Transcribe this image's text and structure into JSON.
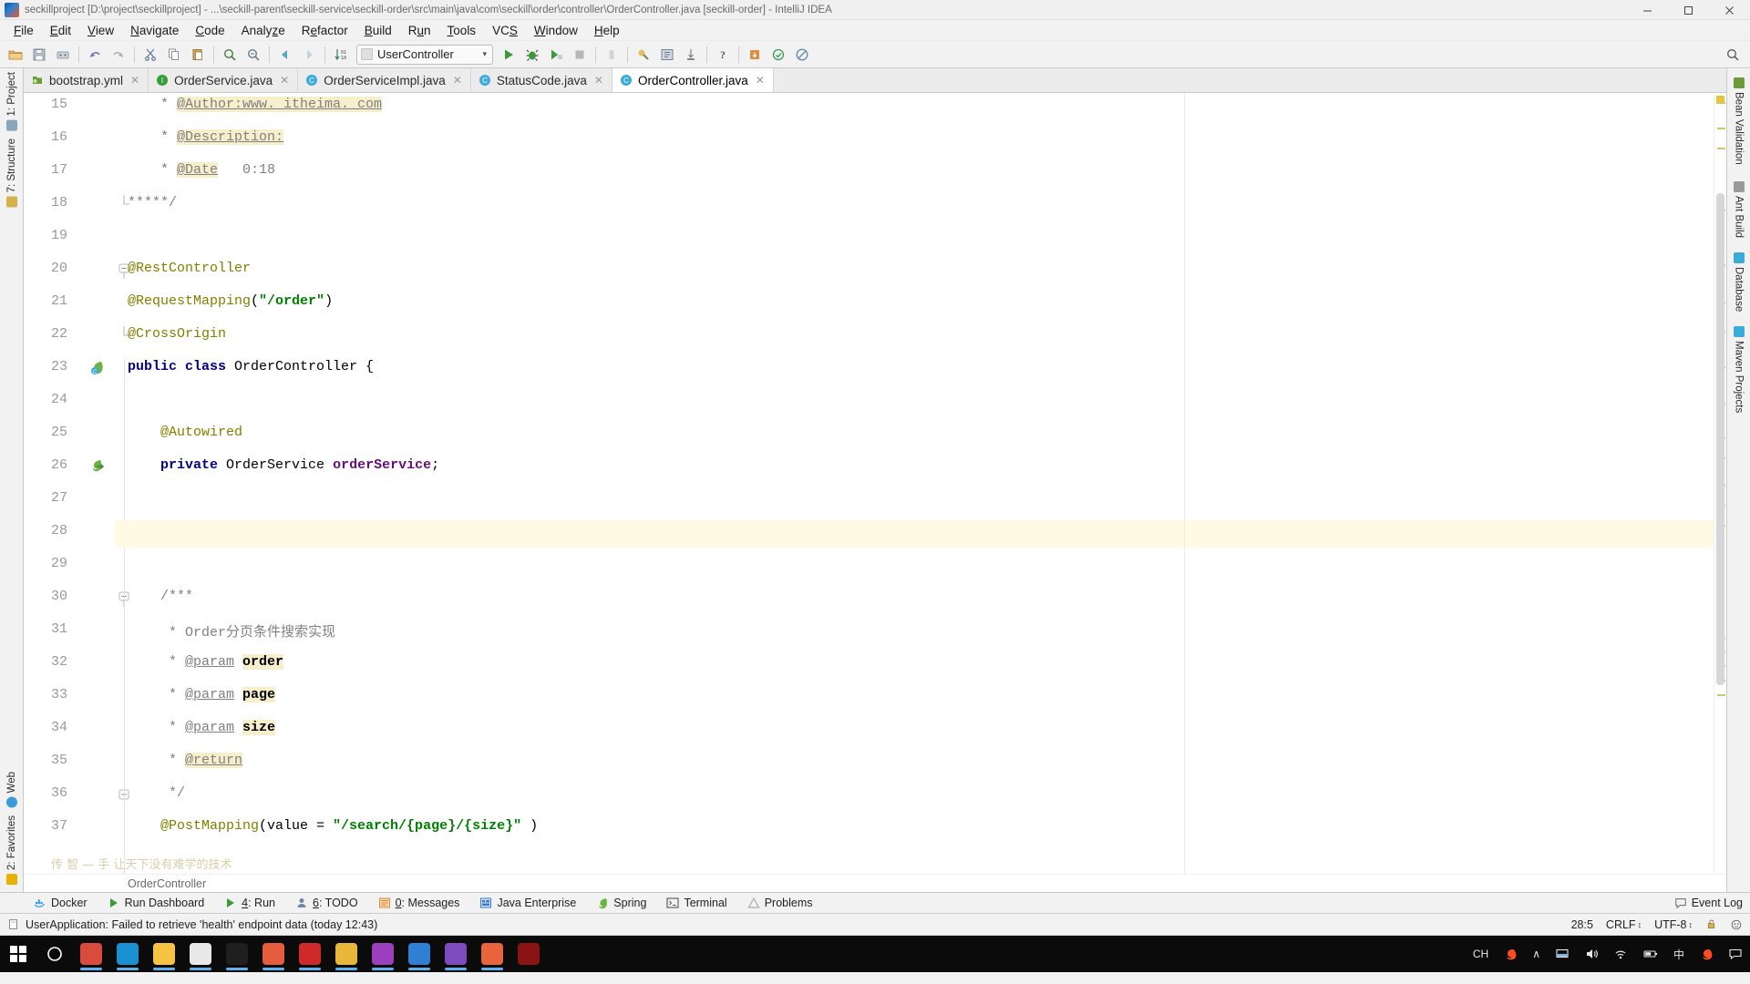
{
  "window": {
    "title": "seckillproject [D:\\project\\seckillproject] - ...\\seckill-parent\\seckill-service\\seckill-order\\src\\main\\java\\com\\seckill\\order\\controller\\OrderController.java [seckill-order] - IntelliJ IDEA",
    "app_icon": "intellij-idea-icon",
    "minimize": "–",
    "maximize": "❐",
    "close": "✕"
  },
  "menubar": {
    "items": [
      {
        "label": "File",
        "mnemonic": "F"
      },
      {
        "label": "Edit",
        "mnemonic": "E"
      },
      {
        "label": "View",
        "mnemonic": "V"
      },
      {
        "label": "Navigate",
        "mnemonic": "N"
      },
      {
        "label": "Code",
        "mnemonic": "C"
      },
      {
        "label": "Analyze",
        "mnemonic": "z"
      },
      {
        "label": "Refactor",
        "mnemonic": "e"
      },
      {
        "label": "Build",
        "mnemonic": "B"
      },
      {
        "label": "Run",
        "mnemonic": "u"
      },
      {
        "label": "Tools",
        "mnemonic": "T"
      },
      {
        "label": "VCS",
        "mnemonic": "S"
      },
      {
        "label": "Window",
        "mnemonic": "W"
      },
      {
        "label": "Help",
        "mnemonic": "H"
      }
    ]
  },
  "toolbar": {
    "left_icons": [
      "open-folder-icon",
      "save-all-icon",
      "sync-icon",
      "undo-icon",
      "redo-icon",
      "cut-icon",
      "copy-icon",
      "paste-icon",
      "find-icon",
      "replace-icon",
      "back-icon",
      "forward-icon",
      "sort-icon"
    ],
    "run_config": {
      "label": "UserController",
      "icon": "run-config-icon",
      "arrow": "⌄"
    },
    "run_icons": [
      "run-icon",
      "debug-icon",
      "run-coverage-icon",
      "stop-icon",
      "stop-disabled-icon",
      "profile-icon",
      "build-project-icon",
      "attach-icon",
      "help-icon",
      "update-app-icon",
      "favorites-icon",
      "no-entry-icon"
    ],
    "right_icons": [
      "search-everywhere-icon"
    ]
  },
  "tabs": [
    {
      "label": "bootstrap.yml",
      "icon": "yml-file-icon",
      "icon_color": "#6a9a3a",
      "icon_letter": "",
      "active": false,
      "closable": true
    },
    {
      "label": "OrderService.java",
      "icon": "java-interface-icon",
      "icon_color": "#389e3c",
      "icon_letter": "I",
      "active": false,
      "closable": true
    },
    {
      "label": "OrderServiceImpl.java",
      "icon": "java-class-icon",
      "icon_color": "#3cabd9",
      "icon_letter": "C",
      "active": false,
      "closable": true
    },
    {
      "label": "StatusCode.java",
      "icon": "java-class-icon",
      "icon_color": "#3cabd9",
      "icon_letter": "C",
      "active": false,
      "closable": true
    },
    {
      "label": "OrderController.java",
      "icon": "java-class-icon",
      "icon_color": "#3cabd9",
      "icon_letter": "C",
      "active": true,
      "closable": true
    }
  ],
  "editor": {
    "breadcrumb": "OrderController",
    "caret_line": 28,
    "first_visible_line": 15,
    "watermark": "传 智 — 手  让天下没有难学的技术",
    "gutter_icons": [
      {
        "line": 23,
        "icon": "spring-bean-class-icon"
      },
      {
        "line": 26,
        "icon": "spring-autowired-icon"
      }
    ],
    "lines": [
      {
        "n": 15,
        "segments": [
          {
            "t": "    * ",
            "c": "cmt"
          },
          {
            "t": "@Author:www. itheima. com",
            "c": "cmt-tag",
            "hl": true
          }
        ]
      },
      {
        "n": 16,
        "segments": [
          {
            "t": "    * ",
            "c": "cmt"
          },
          {
            "t": "@Description:",
            "c": "cmt-tag",
            "hl": true
          }
        ]
      },
      {
        "n": 17,
        "segments": [
          {
            "t": "    * ",
            "c": "cmt"
          },
          {
            "t": "@Date",
            "c": "cmt-tag",
            "hl": true
          },
          {
            "t": "   0:18",
            "c": "cmt"
          }
        ]
      },
      {
        "n": 18,
        "segments": [
          {
            "t": "*****/",
            "c": "cmt"
          }
        ]
      },
      {
        "n": 19,
        "segments": []
      },
      {
        "n": 20,
        "segments": [
          {
            "t": "@RestController",
            "c": "annot"
          }
        ]
      },
      {
        "n": 21,
        "segments": [
          {
            "t": "@RequestMapping",
            "c": "annot"
          },
          {
            "t": "(",
            "c": "plain"
          },
          {
            "t": "\"/order\"",
            "c": "str"
          },
          {
            "t": ")",
            "c": "plain"
          }
        ]
      },
      {
        "n": 22,
        "segments": [
          {
            "t": "@CrossOrigin",
            "c": "annot"
          }
        ]
      },
      {
        "n": 23,
        "segments": [
          {
            "t": "public class ",
            "c": "kw"
          },
          {
            "t": "OrderController {",
            "c": "plain"
          }
        ]
      },
      {
        "n": 24,
        "segments": []
      },
      {
        "n": 25,
        "segments": [
          {
            "t": "    @Autowired",
            "c": "annot"
          }
        ]
      },
      {
        "n": 26,
        "segments": [
          {
            "t": "    private ",
            "c": "kw"
          },
          {
            "t": "OrderService ",
            "c": "plain"
          },
          {
            "t": "orderService",
            "c": "field"
          },
          {
            "t": ";",
            "c": "plain"
          }
        ]
      },
      {
        "n": 27,
        "segments": []
      },
      {
        "n": 28,
        "segments": []
      },
      {
        "n": 29,
        "segments": []
      },
      {
        "n": 30,
        "segments": [
          {
            "t": "    /***",
            "c": "cmt"
          }
        ]
      },
      {
        "n": 31,
        "segments": [
          {
            "t": "     * Order分页条件搜索实现",
            "c": "cmt"
          }
        ]
      },
      {
        "n": 32,
        "segments": [
          {
            "t": "     * ",
            "c": "cmt"
          },
          {
            "t": "@param",
            "c": "cmt-tag"
          },
          {
            "t": " ",
            "c": "cmt"
          },
          {
            "t": "order",
            "c": "plain",
            "hl": true,
            "bold": true
          }
        ]
      },
      {
        "n": 33,
        "segments": [
          {
            "t": "     * ",
            "c": "cmt"
          },
          {
            "t": "@param",
            "c": "cmt-tag"
          },
          {
            "t": " ",
            "c": "cmt"
          },
          {
            "t": "page",
            "c": "plain",
            "hl": true,
            "bold": true
          }
        ]
      },
      {
        "n": 34,
        "segments": [
          {
            "t": "     * ",
            "c": "cmt"
          },
          {
            "t": "@param",
            "c": "cmt-tag"
          },
          {
            "t": " ",
            "c": "cmt"
          },
          {
            "t": "size",
            "c": "plain",
            "hl": true,
            "bold": true
          }
        ]
      },
      {
        "n": 35,
        "segments": [
          {
            "t": "     * ",
            "c": "cmt"
          },
          {
            "t": "@return",
            "c": "cmt-tag",
            "hl": true
          }
        ]
      },
      {
        "n": 36,
        "segments": [
          {
            "t": "     */",
            "c": "cmt"
          }
        ]
      },
      {
        "n": 37,
        "segments": [
          {
            "t": "    @PostMapping",
            "c": "annot"
          },
          {
            "t": "(value = ",
            "c": "plain"
          },
          {
            "t": "\"/search/{page}/{size}\"",
            "c": "str"
          },
          {
            "t": " )",
            "c": "plain"
          }
        ]
      }
    ]
  },
  "left_tool_strip": {
    "top_items": [
      {
        "label": "1: Project",
        "icon": "project-icon",
        "color": "#6a8aa8"
      },
      {
        "label": "7: Structure",
        "icon": "structure-icon",
        "color": "#c9a227"
      }
    ],
    "bottom_items": [
      {
        "label": "Web",
        "icon": "web-icon",
        "color": "#3c9ad9"
      },
      {
        "label": "2: Favorites",
        "icon": "favorites-icon",
        "color": "#e8b100"
      }
    ]
  },
  "right_tool_strip": {
    "items": [
      {
        "label": "Bean Validation",
        "icon": "bean-validation-icon",
        "color": "#6a9a3a"
      },
      {
        "label": "Ant Build",
        "icon": "ant-build-icon",
        "color": "#9a9a9a"
      },
      {
        "label": "Database",
        "icon": "database-icon",
        "color": "#3cabd9"
      },
      {
        "label": "Maven Projects",
        "icon": "maven-icon",
        "color": "#3cabd9"
      }
    ]
  },
  "tool_window_bar": {
    "items": [
      {
        "label": "Docker",
        "mnemonic": "",
        "icon": "docker-icon",
        "color": "#2496ed"
      },
      {
        "label": "Run Dashboard",
        "mnemonic": "",
        "icon": "run-dashboard-icon",
        "color": "#3c9a3c"
      },
      {
        "label": "4: Run",
        "mnemonic": "4",
        "icon": "run-icon",
        "color": "#3c9a3c"
      },
      {
        "label": "6: TODO",
        "mnemonic": "6",
        "icon": "todo-icon",
        "color": "#6a8aa8"
      },
      {
        "label": "0: Messages",
        "mnemonic": "0",
        "icon": "messages-icon",
        "color": "#d98e3c"
      },
      {
        "label": "Java Enterprise",
        "mnemonic": "",
        "icon": "java-enterprise-icon",
        "color": "#3c7ad9"
      },
      {
        "label": "Spring",
        "mnemonic": "",
        "icon": "spring-icon",
        "color": "#6db33f"
      },
      {
        "label": "Terminal",
        "mnemonic": "",
        "icon": "terminal-icon",
        "color": "#555555"
      },
      {
        "label": "Problems",
        "mnemonic": "",
        "icon": "problems-icon",
        "color": "#aaaaaa"
      }
    ],
    "right": {
      "label": "Event Log",
      "icon": "event-log-icon"
    }
  },
  "statusbar": {
    "message": "UserApplication: Failed to retrieve 'health' endpoint data (today 12:43)",
    "message_icon": "info-icon",
    "caret_position": "28:5",
    "line_separator": "CRLF",
    "encoding": "UTF-8",
    "lock_icon": "unlocked-icon",
    "inspection_icon": "inspector-face-icon",
    "stepper": "↕"
  },
  "taskbar": {
    "start_icon": "windows-start-icon",
    "search_icon": "cortana-search-icon",
    "apps": [
      {
        "name": "chrome-icon",
        "color": "#d94b3c",
        "running": true
      },
      {
        "name": "onedrive-icon",
        "color": "#1a8fd1",
        "running": true
      },
      {
        "name": "file-explorer-icon",
        "color": "#f5c242",
        "running": true
      },
      {
        "name": "typora-icon",
        "color": "#e8e8e8",
        "running": true
      },
      {
        "name": "terminal-icon",
        "color": "#1f1f1f",
        "running": true
      },
      {
        "name": "snipaste-icon",
        "color": "#e45b3e",
        "running": true
      },
      {
        "name": "navicat-icon",
        "color": "#cf2a2a",
        "running": true
      },
      {
        "name": "postman-icon",
        "color": "#e8b73a",
        "running": true
      },
      {
        "name": "intellij-idea-icon",
        "color": "#9b3fbe",
        "running": true
      },
      {
        "name": "wechat-dev-icon",
        "color": "#2f7fd4",
        "running": true
      },
      {
        "name": "editor-icon",
        "color": "#7d4bbd",
        "running": true
      },
      {
        "name": "xmind-icon",
        "color": "#e8643c",
        "running": true
      },
      {
        "name": "recorder-icon",
        "color": "#8a1414",
        "running": false
      }
    ],
    "tray": {
      "ime_label": "CH",
      "sogou_icon": "sogou-icon",
      "chevron": "∧",
      "monitor_icon": "monitor-icon",
      "volume_icon": "volume-icon",
      "wifi_icon": "wifi-icon",
      "battery_icon": "battery-icon",
      "ime_mode": "中",
      "sogou_icon_2": "sogou-icon",
      "notification_icon": "notification-icon"
    }
  },
  "colors": {
    "accent": "#3cabd9",
    "spring_green": "#6db33f",
    "annotation": "#808000",
    "keyword": "#000080",
    "string": "#008000",
    "comment": "#808080",
    "field": "#660e7a",
    "current_line": "#fffae3",
    "highlight": "#f7eecb"
  }
}
